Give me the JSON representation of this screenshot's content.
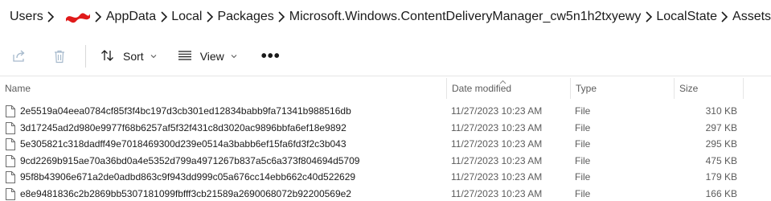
{
  "breadcrumb": {
    "items": [
      "Users",
      "AppData",
      "Local",
      "Packages",
      "Microsoft.Windows.ContentDeliveryManager_cw5n1h2txyewy",
      "LocalState",
      "Assets"
    ]
  },
  "toolbar": {
    "share_icon": "share-icon",
    "delete_icon": "trash-icon",
    "sort_label": "Sort",
    "view_label": "View",
    "more_label": "•••"
  },
  "columns": {
    "name": "Name",
    "date": "Date modified",
    "type": "Type",
    "size": "Size"
  },
  "files": [
    {
      "name": "2e5519a04eea0784cf85f3f4bc197d3cb301ed12834babb9fa71341b988516db",
      "date": "11/27/2023 10:23 AM",
      "type": "File",
      "size": "310 KB"
    },
    {
      "name": "3d17245ad2d980e9977f68b6257af5f32f431c8d3020ac9896bbfa6ef18e9892",
      "date": "11/27/2023 10:23 AM",
      "type": "File",
      "size": "297 KB"
    },
    {
      "name": "5e305821c318dadff49e7018469300d239e0514a3babb6ef15fa6fd3f2c3b043",
      "date": "11/27/2023 10:23 AM",
      "type": "File",
      "size": "295 KB"
    },
    {
      "name": "9cd2269b915ae70a36bd0a4e5352d799a4971267b837a5c6a373f804694d5709",
      "date": "11/27/2023 10:23 AM",
      "type": "File",
      "size": "475 KB"
    },
    {
      "name": "95f8b43906e671a2de0adbd863c9f943dd999c05a676cc14ebb662c40d522629",
      "date": "11/27/2023 10:23 AM",
      "type": "File",
      "size": "179 KB"
    },
    {
      "name": "e8e9481836c2b2869bb5307181099fbfff3cb21589a2690068072b92200569e2",
      "date": "11/27/2023 10:23 AM",
      "type": "File",
      "size": "166 KB"
    }
  ],
  "colors": {
    "redaction": "#e01a1a",
    "icon_disabled": "#a6b9cc",
    "text_secondary": "#5c5c5c"
  }
}
